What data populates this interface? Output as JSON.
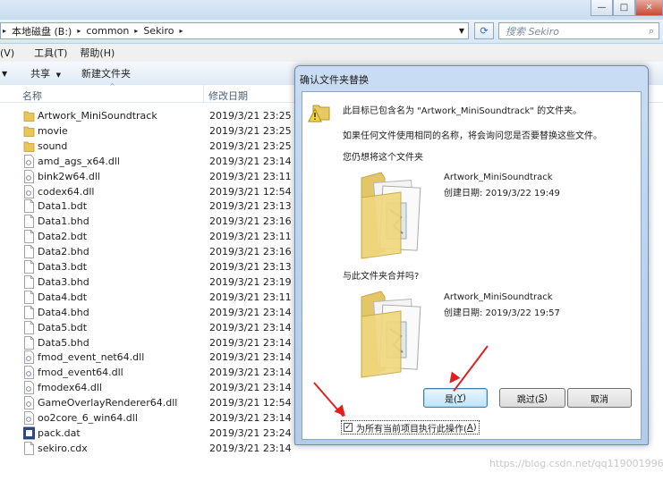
{
  "window": {
    "minimize_glyph": "—",
    "maximize_glyph": "□",
    "close_glyph": "✕"
  },
  "address": {
    "segments": [
      "本地磁盘 (B:)",
      "common",
      "Sekiro"
    ],
    "search_placeholder": "搜索 Sekiro"
  },
  "menu": {
    "items": [
      "(V)",
      "工具(T)",
      "帮助(H)"
    ]
  },
  "toolbar": {
    "share_label": "共享",
    "new_folder_label": "新建文件夹"
  },
  "columns": {
    "name": "名称",
    "date": "修改日期"
  },
  "files": [
    {
      "name": "Artwork_MiniSoundtrack",
      "date": "2019/3/21 23:25",
      "type": "folder"
    },
    {
      "name": "movie",
      "date": "2019/3/21 23:25",
      "type": "folder"
    },
    {
      "name": "sound",
      "date": "2019/3/21 23:25",
      "type": "folder"
    },
    {
      "name": "amd_ags_x64.dll",
      "date": "2019/3/21 23:14",
      "type": "dll"
    },
    {
      "name": "bink2w64.dll",
      "date": "2019/3/21 23:11",
      "type": "dll"
    },
    {
      "name": "codex64.dll",
      "date": "2019/3/21 12:54",
      "type": "dll"
    },
    {
      "name": "Data1.bdt",
      "date": "2019/3/21 23:13",
      "type": "file"
    },
    {
      "name": "Data1.bhd",
      "date": "2019/3/21 23:16",
      "type": "file"
    },
    {
      "name": "Data2.bdt",
      "date": "2019/3/21 23:11",
      "type": "file"
    },
    {
      "name": "Data2.bhd",
      "date": "2019/3/21 23:16",
      "type": "file"
    },
    {
      "name": "Data3.bdt",
      "date": "2019/3/21 23:13",
      "type": "file"
    },
    {
      "name": "Data3.bhd",
      "date": "2019/3/21 23:19",
      "type": "file"
    },
    {
      "name": "Data4.bdt",
      "date": "2019/3/21 23:11",
      "type": "file"
    },
    {
      "name": "Data4.bhd",
      "date": "2019/3/21 23:14",
      "type": "file"
    },
    {
      "name": "Data5.bdt",
      "date": "2019/3/21 23:14",
      "type": "file"
    },
    {
      "name": "Data5.bhd",
      "date": "2019/3/21 23:14",
      "type": "file"
    },
    {
      "name": "fmod_event_net64.dll",
      "date": "2019/3/21 23:14",
      "type": "dll"
    },
    {
      "name": "fmod_event64.dll",
      "date": "2019/3/21 23:14",
      "type": "dll"
    },
    {
      "name": "fmodex64.dll",
      "date": "2019/3/21 23:14",
      "type": "dll"
    },
    {
      "name": "GameOverlayRenderer64.dll",
      "date": "2019/3/21 12:54",
      "type": "dll"
    },
    {
      "name": "oo2core_6_win64.dll",
      "date": "2019/3/21 23:14",
      "type": "dll"
    },
    {
      "name": "pack.dat",
      "date": "2019/3/21 23:24",
      "type": "pack"
    },
    {
      "name": "sekiro.cdx",
      "date": "2019/3/21 23:14",
      "type": "file"
    }
  ],
  "dialog": {
    "title": "确认文件夹替换",
    "message": "此目标已包含名为 \"Artwork_MiniSoundtrack\" 的文件夹。",
    "info": "如果任何文件使用相同的名称，将会询问您是否要替换这些文件。",
    "still_replace": "您仍想将这个文件夹",
    "merge_question": "与此文件夹合并吗?",
    "source": {
      "name": "Artwork_MiniSoundtrack",
      "created": "创建日期: 2019/3/22 19:49"
    },
    "target": {
      "name": "Artwork_MiniSoundtrack",
      "created": "创建日期: 2019/3/22 19:57"
    },
    "yes_text": "是(",
    "yes_key": "Y",
    "skip_text": "跳过(",
    "skip_key": "S",
    "cancel_label": "取消",
    "apply_all_text": "为所有当前项目执行此操作(",
    "apply_all_key": "A",
    "apply_all_checked": true
  },
  "watermark": "https://blog.csdn.net/qq119001996",
  "colors": {
    "accent": "#3c7fb1",
    "annotation_arrow": "#e0201f"
  }
}
